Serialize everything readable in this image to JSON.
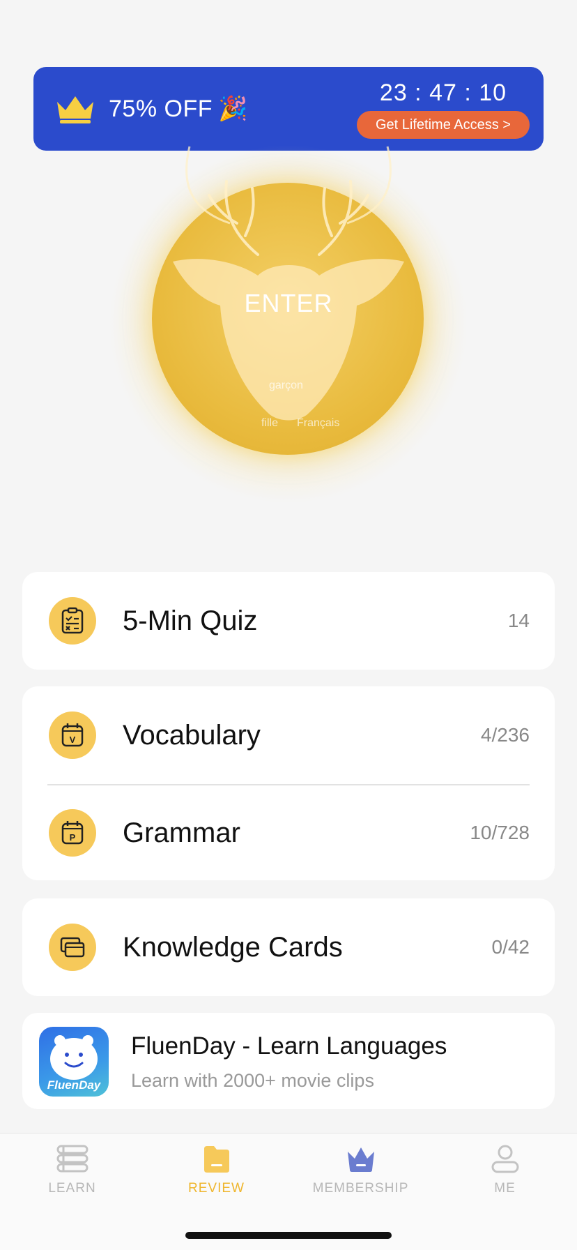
{
  "promo": {
    "offer": "75% OFF",
    "party_emoji": "🎉",
    "timer": "23 : 47 : 10",
    "cta_label": "Get Lifetime Access >"
  },
  "hero": {
    "button_label": "ENTER",
    "words": [
      "garçon",
      "fille",
      "Français"
    ]
  },
  "review_items": [
    {
      "label": "5-Min Quiz",
      "count": "14",
      "icon": "quiz-clipboard-icon"
    },
    {
      "label": "Vocabulary",
      "count": "4/236",
      "icon": "vocabulary-calendar-icon",
      "icon_letter": "V"
    },
    {
      "label": "Grammar",
      "count": "10/728",
      "icon": "grammar-calendar-icon",
      "icon_letter": "P"
    },
    {
      "label": "Knowledge Cards",
      "count": "0/42",
      "icon": "cards-icon"
    }
  ],
  "app_promo": {
    "title": "FluenDay - Learn Languages",
    "subtitle": "Learn with 2000+ movie clips",
    "icon_brand": "FluenDay"
  },
  "tabs": [
    {
      "label": "LEARN",
      "icon": "learn-book-icon",
      "active": false
    },
    {
      "label": "REVIEW",
      "icon": "review-folder-icon",
      "active": true
    },
    {
      "label": "MEMBERSHIP",
      "icon": "membership-crown-icon",
      "active": false
    },
    {
      "label": "ME",
      "icon": "me-person-icon",
      "active": false
    }
  ],
  "colors": {
    "banner": "#2b4bcc",
    "cta": "#e8673a",
    "accent_yellow": "#f6c95a",
    "active_tab": "#efb62e",
    "membership_icon": "#6a7ccf"
  }
}
